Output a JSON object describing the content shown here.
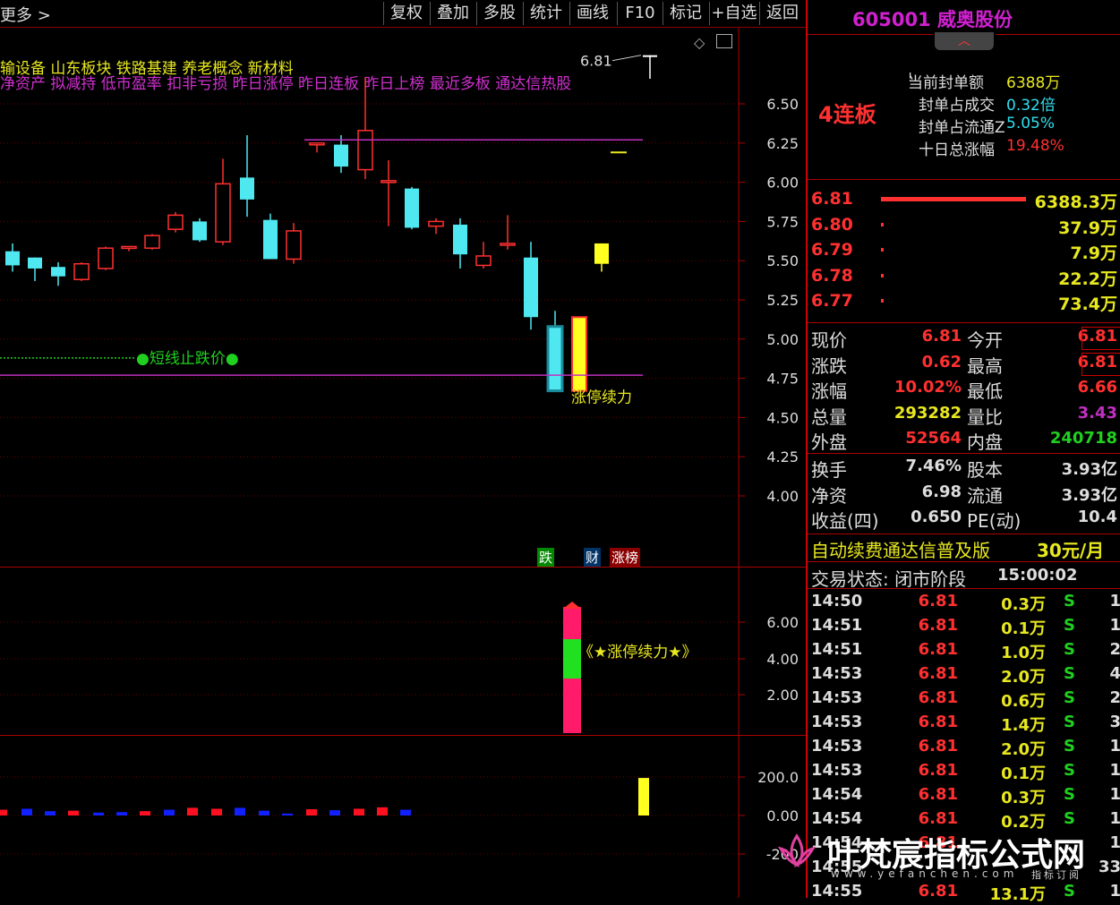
{
  "toolbar": {
    "more_label": "更多 >",
    "buttons": [
      "复权",
      "叠加",
      "多股",
      "统计",
      "画线",
      "F10",
      "标记",
      "+自选",
      "返回"
    ]
  },
  "chart_header": {
    "concepts_line1": "输设备  山东板块  铁路基建 养老概念 新材料",
    "concepts_line2": "净资产 拟减持 低市盈率 扣非亏损 昨日涨停 昨日连板 昨日上榜 最近多板 通达信热股",
    "high_label": "6.81"
  },
  "chart_data": [
    {
      "type": "candlestick",
      "ylim": [
        3.9,
        6.75
      ],
      "y_ticks": [
        "6.50",
        "6.25",
        "6.00",
        "5.75",
        "5.50",
        "5.25",
        "5.00",
        "4.75",
        "4.50",
        "4.25",
        "4.00"
      ],
      "candles": [
        {
          "o": 5.56,
          "h": 5.61,
          "l": 5.43,
          "c": 5.47
        },
        {
          "o": 5.52,
          "h": 5.52,
          "l": 5.37,
          "c": 5.45
        },
        {
          "o": 5.46,
          "h": 5.49,
          "l": 5.34,
          "c": 5.4
        },
        {
          "o": 5.38,
          "h": 5.49,
          "l": 5.37,
          "c": 5.48
        },
        {
          "o": 5.45,
          "h": 5.59,
          "l": 5.44,
          "c": 5.58
        },
        {
          "o": 5.58,
          "h": 5.59,
          "l": 5.56,
          "c": 5.59
        },
        {
          "o": 5.58,
          "h": 5.67,
          "l": 5.57,
          "c": 5.66
        },
        {
          "o": 5.7,
          "h": 5.81,
          "l": 5.68,
          "c": 5.79
        },
        {
          "o": 5.75,
          "h": 5.77,
          "l": 5.62,
          "c": 5.63
        },
        {
          "o": 5.62,
          "h": 6.15,
          "l": 5.6,
          "c": 5.99
        },
        {
          "o": 6.03,
          "h": 6.3,
          "l": 5.78,
          "c": 5.89
        },
        {
          "o": 5.76,
          "h": 5.8,
          "l": 5.51,
          "c": 5.51
        },
        {
          "o": 5.51,
          "h": 5.74,
          "l": 5.48,
          "c": 5.69
        },
        {
          "o": 6.25,
          "h": 6.25,
          "l": 6.19,
          "c": 6.25
        },
        {
          "o": 6.24,
          "h": 6.3,
          "l": 6.06,
          "c": 6.1
        },
        {
          "o": 6.08,
          "h": 6.67,
          "l": 6.02,
          "c": 6.33
        },
        {
          "o": 6.01,
          "h": 6.14,
          "l": 5.72,
          "c": 6.01
        },
        {
          "o": 5.96,
          "h": 5.97,
          "l": 5.7,
          "c": 5.71
        },
        {
          "o": 5.72,
          "h": 5.77,
          "l": 5.67,
          "c": 5.75
        },
        {
          "o": 5.73,
          "h": 5.77,
          "l": 5.45,
          "c": 5.54
        },
        {
          "o": 5.47,
          "h": 5.62,
          "l": 5.45,
          "c": 5.53
        },
        {
          "o": 5.61,
          "h": 5.79,
          "l": 5.57,
          "c": 5.61
        },
        {
          "o": 5.52,
          "h": 5.62,
          "l": 5.06,
          "c": 5.14
        },
        {
          "o": 5.08,
          "h": 5.18,
          "l": 4.67,
          "c": 4.67
        },
        {
          "o": 4.67,
          "h": 5.14,
          "l": 4.67,
          "c": 5.14
        },
        {
          "o": 5.61,
          "h": 5.61,
          "l": 5.43,
          "c": 5.48
        },
        {
          "o": 6.81,
          "h": 6.81,
          "l": 6.66,
          "c": 6.81
        }
      ],
      "stop_loss_label": "●短线止跌价●",
      "signal_label": "涨停续力"
    },
    {
      "type": "bar",
      "y_ticks": [
        "6.00",
        "4.00",
        "2.00"
      ],
      "label": "《★涨停续力★》"
    },
    {
      "type": "bar",
      "y_ticks": [
        "200.0",
        "0.00",
        "-200"
      ],
      "values": [
        60,
        70,
        45,
        50,
        30,
        35,
        45,
        60,
        80,
        70,
        80,
        50,
        20,
        65,
        55,
        70,
        85,
        60,
        0,
        0,
        0,
        0,
        0,
        0,
        0,
        0,
        150
      ],
      "colors": [
        "red",
        "blue",
        "blue",
        "red",
        "blue",
        "blue",
        "red",
        "blue",
        "red",
        "red",
        "blue",
        "blue",
        "blue",
        "red",
        "blue",
        "red",
        "red",
        "blue",
        "none",
        "none",
        "none",
        "none",
        "none",
        "none",
        "none",
        "none",
        "yellow"
      ]
    }
  ],
  "tags": {
    "die": "跌",
    "cai": "财",
    "zhangbang": "涨榜"
  },
  "stock": {
    "code_name": "605001 威奥股份",
    "board_label": "4连板",
    "seal_rows": [
      {
        "label": "当前封单额",
        "value": "6388万"
      },
      {
        "label": "封单占成交",
        "value": "0.32倍"
      },
      {
        "label": "封单占流通Z",
        "value": "5.05%"
      },
      {
        "label": "十日总涨幅",
        "value": "19.48%"
      }
    ],
    "bids": [
      {
        "price": "6.81",
        "bar": 1.0,
        "vol": "6388.3万"
      },
      {
        "price": "6.80",
        "bar": 0.006,
        "vol": "37.9万"
      },
      {
        "price": "6.79",
        "bar": 0.001,
        "vol": "7.9万"
      },
      {
        "price": "6.78",
        "bar": 0.004,
        "vol": "22.2万"
      },
      {
        "price": "6.77",
        "bar": 0.012,
        "vol": "73.4万"
      }
    ],
    "quote": {
      "xianjia_l": "现价",
      "xianjia": "6.81",
      "jinkai_l": "今开",
      "jinkai": "6.81",
      "zhangdie_l": "涨跌",
      "zhangdie": "0.62",
      "zuigao_l": "最高",
      "zuigao": "6.81",
      "zhangfu_l": "涨幅",
      "zhangfu": "10.02%",
      "zuidi_l": "最低",
      "zuidi": "6.66",
      "zongliang_l": "总量",
      "zongliang": "293282",
      "liangbi_l": "量比",
      "liangbi": "3.43",
      "waipan_l": "外盘",
      "waipan": "52564",
      "neipan_l": "内盘",
      "neipan": "240718"
    },
    "fund": {
      "huanshou_l": "换手",
      "huanshou": "7.46%",
      "guben_l": "股本",
      "guben": "3.93亿",
      "jingzi_l": "净资",
      "jingzi": "6.98",
      "liutong_l": "流通",
      "liutong": "3.93亿",
      "shouyi_l": "收益(四)",
      "shouyi": "0.650",
      "pe_l": "PE(动)",
      "pe": "10.4"
    },
    "promo": "自动续费通达信普及版",
    "promo_price": "30元/月",
    "status": "交易状态: 闭市阶段",
    "status_time": "15:00:02",
    "ticks": [
      {
        "t": "14:50",
        "p": "6.81",
        "v": "0.3万",
        "s": "S",
        "n": "1"
      },
      {
        "t": "14:51",
        "p": "6.81",
        "v": "0.1万",
        "s": "S",
        "n": "1"
      },
      {
        "t": "14:51",
        "p": "6.81",
        "v": "1.0万",
        "s": "S",
        "n": "2"
      },
      {
        "t": "14:53",
        "p": "6.81",
        "v": "2.0万",
        "s": "S",
        "n": "4"
      },
      {
        "t": "14:53",
        "p": "6.81",
        "v": "0.6万",
        "s": "S",
        "n": "2"
      },
      {
        "t": "14:53",
        "p": "6.81",
        "v": "1.4万",
        "s": "S",
        "n": "3"
      },
      {
        "t": "14:53",
        "p": "6.81",
        "v": "2.0万",
        "s": "S",
        "n": "1"
      },
      {
        "t": "14:53",
        "p": "6.81",
        "v": "0.1万",
        "s": "S",
        "n": "1"
      },
      {
        "t": "14:54",
        "p": "6.81",
        "v": "0.3万",
        "s": "S",
        "n": "1"
      },
      {
        "t": "14:54",
        "p": "6.81",
        "v": "0.2万",
        "s": "S",
        "n": "1"
      },
      {
        "t": "14:54",
        "p": "6.81",
        "v": "",
        "s": "",
        "n": "1"
      },
      {
        "t": "14:55",
        "p": "",
        "v": "",
        "s": "",
        "n": "33"
      },
      {
        "t": "14:55",
        "p": "6.81",
        "v": "13.1万",
        "s": "S",
        "n": "1"
      }
    ]
  },
  "watermark": {
    "title": "叶梵宸指标公式网",
    "url": "www.yefanchen.com",
    "tag": "指标订阅"
  }
}
